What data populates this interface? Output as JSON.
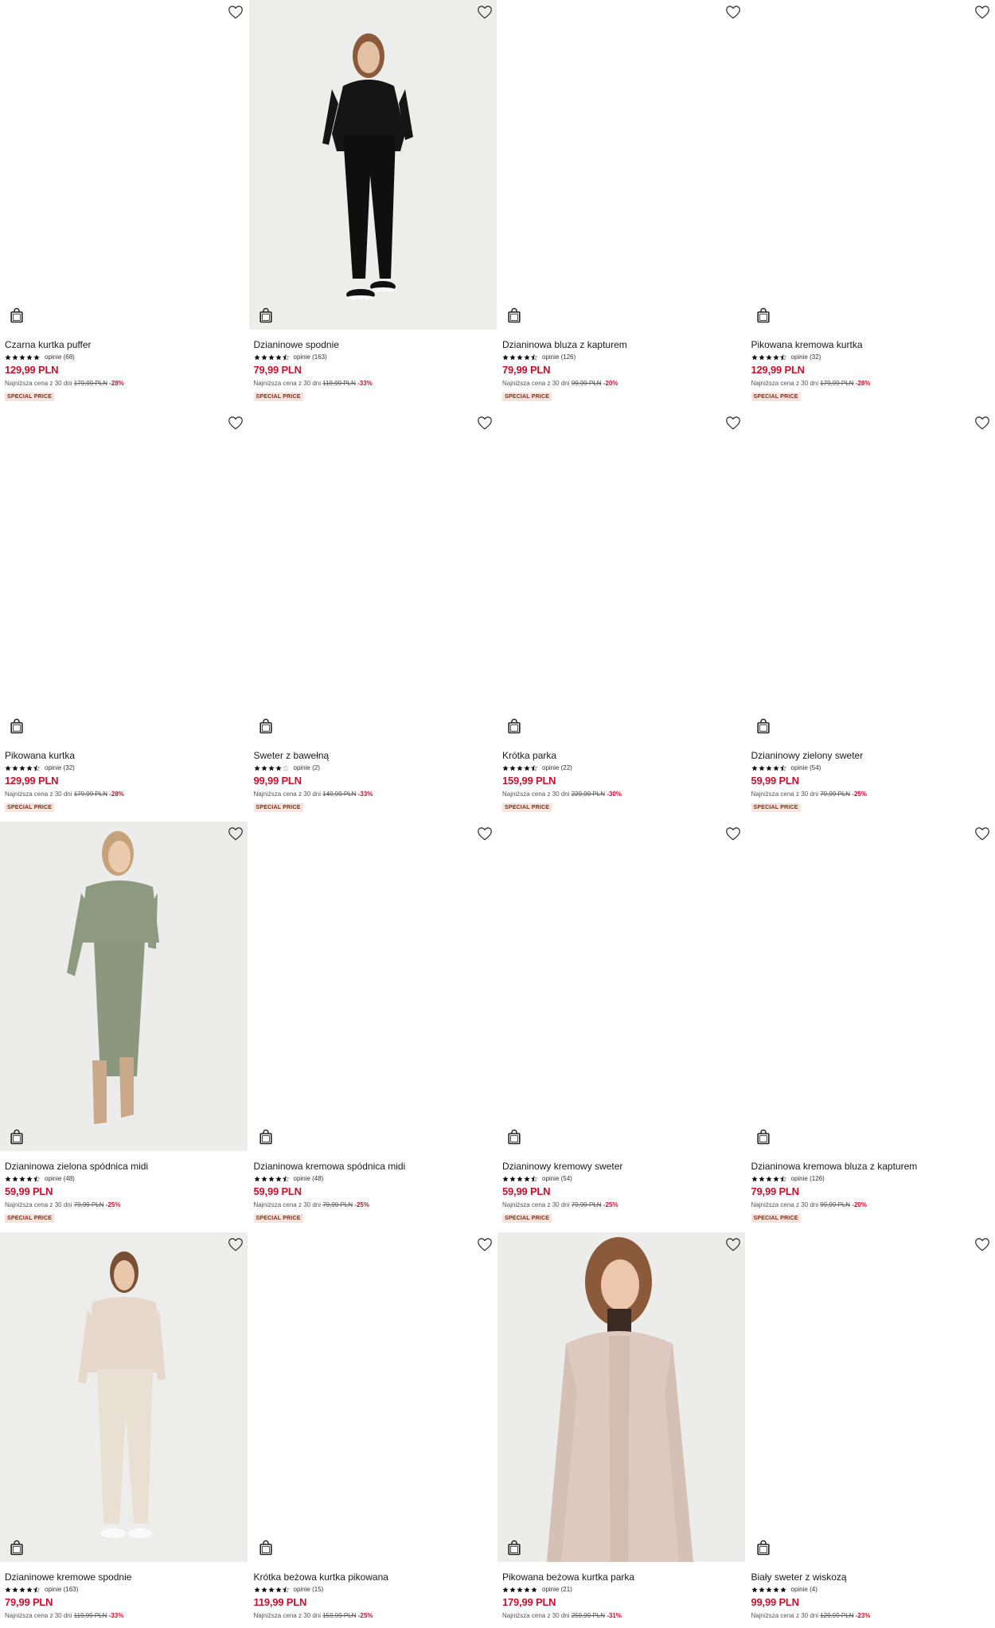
{
  "labels": {
    "lowest_prefix": "Najniższa cena z 30 dni",
    "reviews_prefix": "opinie",
    "badge": "SPECIAL PRICE"
  },
  "colors": {
    "price": "#c8102e",
    "badge_bg": "#f6e3db",
    "badge_text": "#8a2a1c"
  },
  "products": [
    {
      "name": "Czarna kurtka puffer",
      "rating": 5,
      "reviews": "opinie (68)",
      "price": "129,99 PLN",
      "lowest_prefix": "Najniższa cena z 30 dni",
      "old_price": "179,99 PLN",
      "discount": "-28%",
      "badge": "SPECIAL PRICE",
      "photo": "none"
    },
    {
      "name": "Dzianinowe spodnie",
      "rating": 4.5,
      "reviews": "opinie (163)",
      "price": "79,99 PLN",
      "lowest_prefix": "Najniższa cena z 30 dni",
      "old_price": "119,99 PLN",
      "discount": "-33%",
      "badge": "SPECIAL PRICE",
      "photo": "black-outfit"
    },
    {
      "name": "Dzianinowa bluza z kapturem",
      "rating": 4.5,
      "reviews": "opinie (126)",
      "price": "79,99 PLN",
      "lowest_prefix": "Najniższa cena z 30 dni",
      "old_price": "99,99 PLN",
      "discount": "-20%",
      "badge": "SPECIAL PRICE",
      "photo": "none"
    },
    {
      "name": "Pikowana kremowa kurtka",
      "rating": 4.5,
      "reviews": "opinie (32)",
      "price": "129,99 PLN",
      "lowest_prefix": "Najniższa cena z 30 dni",
      "old_price": "179,99 PLN",
      "discount": "-28%",
      "badge": "SPECIAL PRICE",
      "photo": "none"
    },
    {
      "name": "Pikowana kurtka",
      "rating": 4.5,
      "reviews": "opinie (32)",
      "price": "129,99 PLN",
      "lowest_prefix": "Najniższa cena z 30 dni",
      "old_price": "179,99 PLN",
      "discount": "-28%",
      "badge": "SPECIAL PRICE",
      "photo": "none"
    },
    {
      "name": "Sweter z bawełną",
      "rating": 4,
      "reviews": "opinie (2)",
      "price": "99,99 PLN",
      "lowest_prefix": "Najniższa cena z 30 dni",
      "old_price": "149,99 PLN",
      "discount": "-33%",
      "badge": "SPECIAL PRICE",
      "photo": "none"
    },
    {
      "name": "Krótka parka",
      "rating": 4.5,
      "reviews": "opinie (22)",
      "price": "159,99 PLN",
      "lowest_prefix": "Najniższa cena z 30 dni",
      "old_price": "229,99 PLN",
      "discount": "-30%",
      "badge": "SPECIAL PRICE",
      "photo": "none"
    },
    {
      "name": "Dzianinowy zielony sweter",
      "rating": 4.5,
      "reviews": "opinie (54)",
      "price": "59,99 PLN",
      "lowest_prefix": "Najniższa cena z 30 dni",
      "old_price": "79,99 PLN",
      "discount": "-25%",
      "badge": "SPECIAL PRICE",
      "photo": "none"
    },
    {
      "name": "Dzianinowa zielona spódnica midi",
      "rating": 4.5,
      "reviews": "opinie (48)",
      "price": "59,99 PLN",
      "lowest_prefix": "Najniższa cena z 30 dni",
      "old_price": "79,99 PLN",
      "discount": "-25%",
      "badge": "SPECIAL PRICE",
      "photo": "green-outfit"
    },
    {
      "name": "Dzianinowa kremowa spódnica midi",
      "rating": 4.5,
      "reviews": "opinie (48)",
      "price": "59,99 PLN",
      "lowest_prefix": "Najniższa cena z 30 dni",
      "old_price": "79,99 PLN",
      "discount": "-25%",
      "badge": "SPECIAL PRICE",
      "photo": "none"
    },
    {
      "name": "Dzianinowy kremowy sweter",
      "rating": 4.5,
      "reviews": "opinie (54)",
      "price": "59,99 PLN",
      "lowest_prefix": "Najniższa cena z 30 dni",
      "old_price": "79,99 PLN",
      "discount": "-25%",
      "badge": "SPECIAL PRICE",
      "photo": "none"
    },
    {
      "name": "Dzianinowa kremowa bluza z kapturem",
      "rating": 4.5,
      "reviews": "opinie (126)",
      "price": "79,99 PLN",
      "lowest_prefix": "Najniższa cena z 30 dni",
      "old_price": "99,99 PLN",
      "discount": "-20%",
      "badge": "SPECIAL PRICE",
      "photo": "none"
    },
    {
      "name": "Dzianinowe kremowe spodnie",
      "rating": 4.5,
      "reviews": "opinie (163)",
      "price": "79,99 PLN",
      "lowest_prefix": "Najniższa cena z 30 dni",
      "old_price": "119,99 PLN",
      "discount": "-33%",
      "badge": "",
      "photo": "cream-outfit"
    },
    {
      "name": "Krótka beżowa kurtka pikowana",
      "rating": 4.5,
      "reviews": "opinie (15)",
      "price": "119,99 PLN",
      "lowest_prefix": "Najniższa cena z 30 dni",
      "old_price": "159,99 PLN",
      "discount": "-25%",
      "badge": "",
      "photo": "none"
    },
    {
      "name": "Pikowana beżowa kurtka parka",
      "rating": 5,
      "reviews": "opinie (21)",
      "price": "179,99 PLN",
      "lowest_prefix": "Najniższa cena z 30 dni",
      "old_price": "259,99 PLN",
      "discount": "-31%",
      "badge": "",
      "photo": "parka"
    },
    {
      "name": "Biały sweter z wiskozą",
      "rating": 5,
      "reviews": "opinie (4)",
      "price": "99,99 PLN",
      "lowest_prefix": "Najniższa cena z 30 dni",
      "old_price": "129,99 PLN",
      "discount": "-23%",
      "badge": "",
      "photo": "none"
    }
  ]
}
